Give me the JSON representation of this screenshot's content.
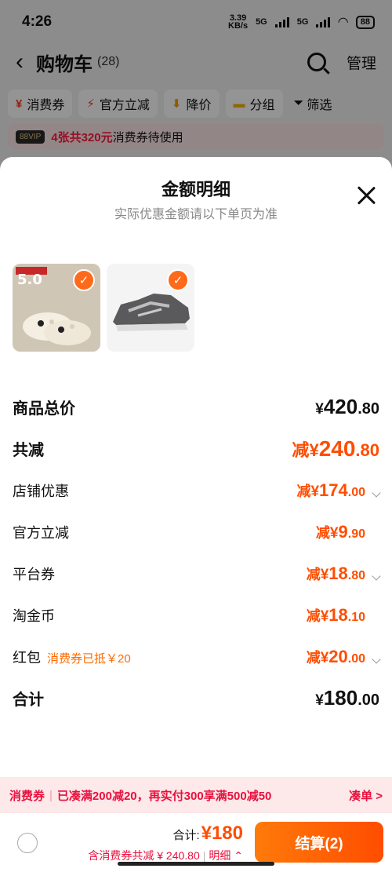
{
  "status_bar": {
    "time": "4:26",
    "speed_top": "3.39",
    "speed_bottom": "KB/s",
    "net1": "5G",
    "net2": "5G",
    "battery": "88"
  },
  "nav": {
    "title": "购物车",
    "count": "(28)",
    "manage": "管理"
  },
  "filters": [
    {
      "icon": "coupon-icon",
      "label": "消费券"
    },
    {
      "icon": "lightning-icon",
      "label": "官方立减"
    },
    {
      "icon": "price-down-icon",
      "label": "降价"
    },
    {
      "icon": "folder-icon",
      "label": "分组"
    }
  ],
  "filter_link": "筛选",
  "vip_bar": {
    "badge": "88VIP",
    "highlight": "4张共320元",
    "text": "消费券待使用"
  },
  "sheet": {
    "title": "金额明细",
    "subtitle": "实际优惠金额请以下单页为准",
    "products": [
      {
        "name": "clog-shoe",
        "badge": "5.0"
      },
      {
        "name": "sneaker"
      }
    ],
    "rows": [
      {
        "label": "商品总价",
        "prefix": "",
        "yen": "¥",
        "int": "420",
        "dec": ".80"
      },
      {
        "label": "共减",
        "prefix": "减",
        "yen": "¥",
        "int": "240",
        "dec": ".80"
      },
      {
        "label": "店铺优惠",
        "prefix": "减",
        "yen": "¥",
        "int": "174",
        "dec": ".00"
      },
      {
        "label": "官方立减",
        "prefix": "减",
        "yen": "¥",
        "int": "9",
        "dec": ".90"
      },
      {
        "label": "平台券",
        "prefix": "减",
        "yen": "¥",
        "int": "18",
        "dec": ".80"
      },
      {
        "label": "淘金币",
        "prefix": "减",
        "yen": "¥",
        "int": "18",
        "dec": ".10"
      },
      {
        "label": "红包",
        "tag": "消费券已抵￥20",
        "prefix": "减",
        "yen": "¥",
        "int": "20",
        "dec": ".00"
      },
      {
        "label": "合计",
        "prefix": "",
        "yen": "¥",
        "int": "180",
        "dec": ".00"
      }
    ]
  },
  "promo": {
    "label": "消费券",
    "text": "已凑满200减20，再实付300享满500减50",
    "action": "凑单 >"
  },
  "footer": {
    "total_label": "合计:",
    "total": "¥180",
    "saving": "含消费券共减 ¥ 240.80",
    "detail": "明细 ⌃",
    "pay_button": "结算(2)"
  },
  "colors": {
    "accent": "#ff4d00",
    "promo_red": "#e8103c",
    "check": "#ff6a1a"
  }
}
